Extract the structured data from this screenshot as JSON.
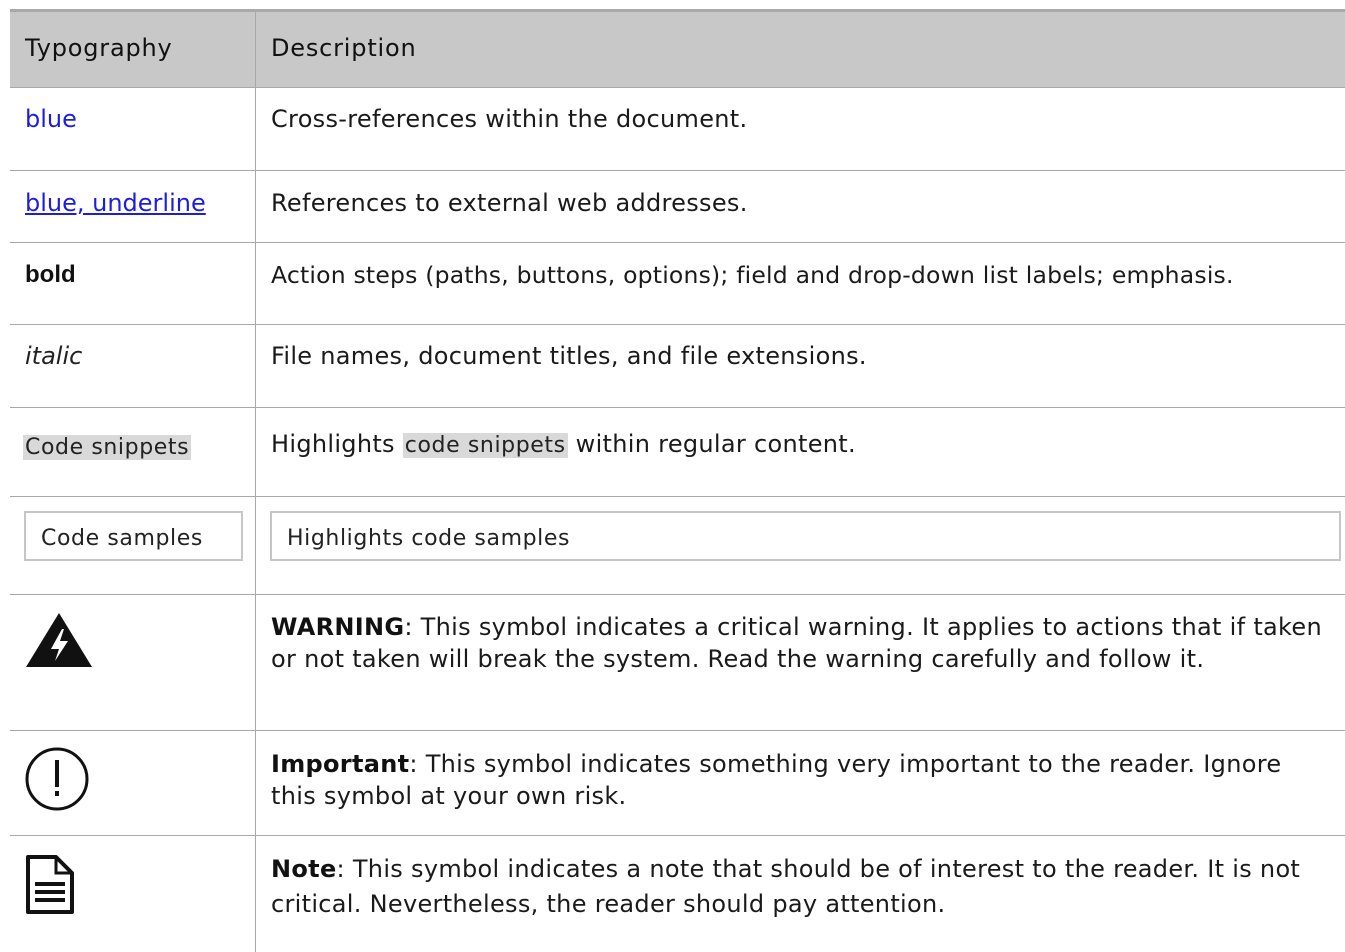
{
  "header": {
    "col1": "Typography",
    "col2": "Description"
  },
  "rows": [
    {
      "example": "blue",
      "description": "Cross-references within the document."
    },
    {
      "example": "blue, underline",
      "description": "References to external web addresses."
    },
    {
      "example": "bold",
      "description": "Action steps (paths, buttons, options); field and drop-down list labels; emphasis."
    },
    {
      "example": "italic",
      "description": "File names, document titles, and file extensions."
    },
    {
      "example": "Code snippets",
      "description_before": "Highlights ",
      "description_code": "code snippets",
      "description_after": " within regular content."
    },
    {
      "example": "Code samples",
      "description": "Highlights code samples"
    },
    {
      "icon": "warning-lightning-icon",
      "keyword": "WARNING",
      "description": ": This symbol indicates a critical warning. It applies to actions that if taken or not taken will break the system. Read the warning carefully and follow it."
    },
    {
      "icon": "important-exclamation-icon",
      "keyword": "Important",
      "description": ": This symbol indicates something very important to the reader. Ignore this symbol at your own risk."
    },
    {
      "icon": "note-document-icon",
      "keyword": "Note",
      "description": ": This symbol indicates a note that should be of interest to the reader. It is not critical. Nevertheless, the reader should pay attention."
    }
  ],
  "colors": {
    "link": "#1d1de0",
    "header_bg": "#c8c8c8",
    "code_bg": "#d9d9d9",
    "rule": "#a8a8a8"
  }
}
